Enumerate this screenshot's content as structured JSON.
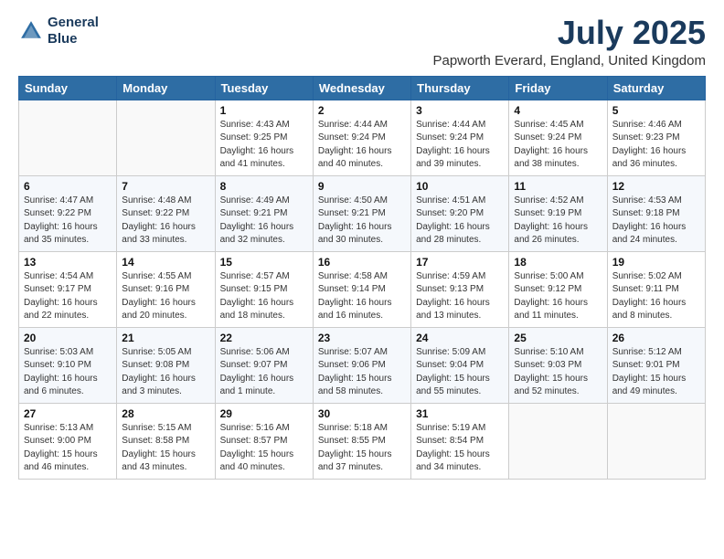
{
  "header": {
    "logo_line1": "General",
    "logo_line2": "Blue",
    "title": "July 2025",
    "subtitle": "Papworth Everard, England, United Kingdom"
  },
  "calendar": {
    "days_of_week": [
      "Sunday",
      "Monday",
      "Tuesday",
      "Wednesday",
      "Thursday",
      "Friday",
      "Saturday"
    ],
    "weeks": [
      [
        {
          "day": "",
          "info": ""
        },
        {
          "day": "",
          "info": ""
        },
        {
          "day": "1",
          "info": "Sunrise: 4:43 AM\nSunset: 9:25 PM\nDaylight: 16 hours and 41 minutes."
        },
        {
          "day": "2",
          "info": "Sunrise: 4:44 AM\nSunset: 9:24 PM\nDaylight: 16 hours and 40 minutes."
        },
        {
          "day": "3",
          "info": "Sunrise: 4:44 AM\nSunset: 9:24 PM\nDaylight: 16 hours and 39 minutes."
        },
        {
          "day": "4",
          "info": "Sunrise: 4:45 AM\nSunset: 9:24 PM\nDaylight: 16 hours and 38 minutes."
        },
        {
          "day": "5",
          "info": "Sunrise: 4:46 AM\nSunset: 9:23 PM\nDaylight: 16 hours and 36 minutes."
        }
      ],
      [
        {
          "day": "6",
          "info": "Sunrise: 4:47 AM\nSunset: 9:22 PM\nDaylight: 16 hours and 35 minutes."
        },
        {
          "day": "7",
          "info": "Sunrise: 4:48 AM\nSunset: 9:22 PM\nDaylight: 16 hours and 33 minutes."
        },
        {
          "day": "8",
          "info": "Sunrise: 4:49 AM\nSunset: 9:21 PM\nDaylight: 16 hours and 32 minutes."
        },
        {
          "day": "9",
          "info": "Sunrise: 4:50 AM\nSunset: 9:21 PM\nDaylight: 16 hours and 30 minutes."
        },
        {
          "day": "10",
          "info": "Sunrise: 4:51 AM\nSunset: 9:20 PM\nDaylight: 16 hours and 28 minutes."
        },
        {
          "day": "11",
          "info": "Sunrise: 4:52 AM\nSunset: 9:19 PM\nDaylight: 16 hours and 26 minutes."
        },
        {
          "day": "12",
          "info": "Sunrise: 4:53 AM\nSunset: 9:18 PM\nDaylight: 16 hours and 24 minutes."
        }
      ],
      [
        {
          "day": "13",
          "info": "Sunrise: 4:54 AM\nSunset: 9:17 PM\nDaylight: 16 hours and 22 minutes."
        },
        {
          "day": "14",
          "info": "Sunrise: 4:55 AM\nSunset: 9:16 PM\nDaylight: 16 hours and 20 minutes."
        },
        {
          "day": "15",
          "info": "Sunrise: 4:57 AM\nSunset: 9:15 PM\nDaylight: 16 hours and 18 minutes."
        },
        {
          "day": "16",
          "info": "Sunrise: 4:58 AM\nSunset: 9:14 PM\nDaylight: 16 hours and 16 minutes."
        },
        {
          "day": "17",
          "info": "Sunrise: 4:59 AM\nSunset: 9:13 PM\nDaylight: 16 hours and 13 minutes."
        },
        {
          "day": "18",
          "info": "Sunrise: 5:00 AM\nSunset: 9:12 PM\nDaylight: 16 hours and 11 minutes."
        },
        {
          "day": "19",
          "info": "Sunrise: 5:02 AM\nSunset: 9:11 PM\nDaylight: 16 hours and 8 minutes."
        }
      ],
      [
        {
          "day": "20",
          "info": "Sunrise: 5:03 AM\nSunset: 9:10 PM\nDaylight: 16 hours and 6 minutes."
        },
        {
          "day": "21",
          "info": "Sunrise: 5:05 AM\nSunset: 9:08 PM\nDaylight: 16 hours and 3 minutes."
        },
        {
          "day": "22",
          "info": "Sunrise: 5:06 AM\nSunset: 9:07 PM\nDaylight: 16 hours and 1 minute."
        },
        {
          "day": "23",
          "info": "Sunrise: 5:07 AM\nSunset: 9:06 PM\nDaylight: 15 hours and 58 minutes."
        },
        {
          "day": "24",
          "info": "Sunrise: 5:09 AM\nSunset: 9:04 PM\nDaylight: 15 hours and 55 minutes."
        },
        {
          "day": "25",
          "info": "Sunrise: 5:10 AM\nSunset: 9:03 PM\nDaylight: 15 hours and 52 minutes."
        },
        {
          "day": "26",
          "info": "Sunrise: 5:12 AM\nSunset: 9:01 PM\nDaylight: 15 hours and 49 minutes."
        }
      ],
      [
        {
          "day": "27",
          "info": "Sunrise: 5:13 AM\nSunset: 9:00 PM\nDaylight: 15 hours and 46 minutes."
        },
        {
          "day": "28",
          "info": "Sunrise: 5:15 AM\nSunset: 8:58 PM\nDaylight: 15 hours and 43 minutes."
        },
        {
          "day": "29",
          "info": "Sunrise: 5:16 AM\nSunset: 8:57 PM\nDaylight: 15 hours and 40 minutes."
        },
        {
          "day": "30",
          "info": "Sunrise: 5:18 AM\nSunset: 8:55 PM\nDaylight: 15 hours and 37 minutes."
        },
        {
          "day": "31",
          "info": "Sunrise: 5:19 AM\nSunset: 8:54 PM\nDaylight: 15 hours and 34 minutes."
        },
        {
          "day": "",
          "info": ""
        },
        {
          "day": "",
          "info": ""
        }
      ]
    ]
  }
}
